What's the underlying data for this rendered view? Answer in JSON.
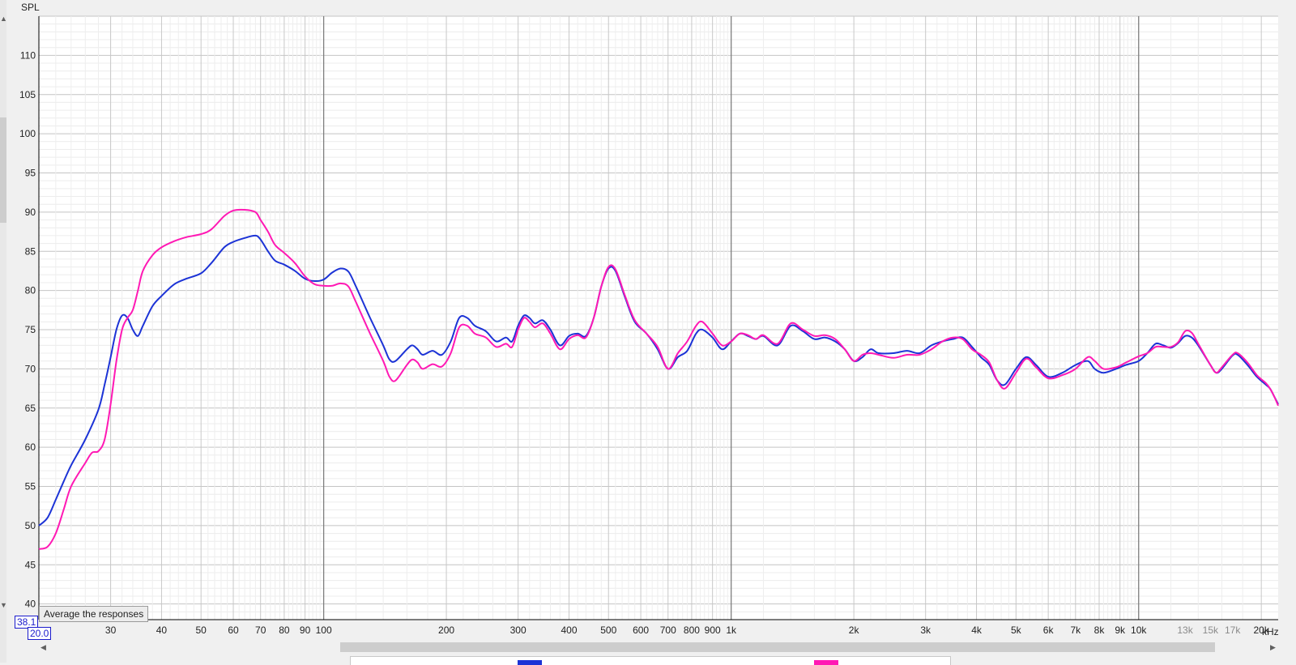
{
  "ylabel": "SPL",
  "xunit": "kHz",
  "cursor": {
    "y": "38.1",
    "x": "20.0"
  },
  "tooltip": "Average the responses",
  "colors": {
    "series1": "#1c33d6",
    "series2": "#ff19b4",
    "grid": "#d5d5d5",
    "grid_major": "#7a7a7a"
  },
  "chart_data": {
    "type": "line",
    "x_scale": "log",
    "xlim": [
      20,
      22000
    ],
    "ylim": [
      38,
      115
    ],
    "ylabel": "SPL",
    "y_ticks": [
      40,
      45,
      50,
      55,
      60,
      65,
      70,
      75,
      80,
      85,
      90,
      95,
      100,
      105,
      110
    ],
    "x_ticks": [
      {
        "v": 30,
        "label": "30"
      },
      {
        "v": 40,
        "label": "40"
      },
      {
        "v": 50,
        "label": "50"
      },
      {
        "v": 60,
        "label": "60"
      },
      {
        "v": 70,
        "label": "70"
      },
      {
        "v": 80,
        "label": "80"
      },
      {
        "v": 90,
        "label": "90"
      },
      {
        "v": 100,
        "label": "100"
      },
      {
        "v": 200,
        "label": "200"
      },
      {
        "v": 300,
        "label": "300"
      },
      {
        "v": 400,
        "label": "400"
      },
      {
        "v": 500,
        "label": "500"
      },
      {
        "v": 600,
        "label": "600"
      },
      {
        "v": 700,
        "label": "700"
      },
      {
        "v": 800,
        "label": "800"
      },
      {
        "v": 900,
        "label": "900"
      },
      {
        "v": 1000,
        "label": "1k"
      },
      {
        "v": 2000,
        "label": "2k"
      },
      {
        "v": 3000,
        "label": "3k"
      },
      {
        "v": 4000,
        "label": "4k"
      },
      {
        "v": 5000,
        "label": "5k"
      },
      {
        "v": 6000,
        "label": "6k"
      },
      {
        "v": 7000,
        "label": "7k"
      },
      {
        "v": 8000,
        "label": "8k"
      },
      {
        "v": 9000,
        "label": "9k"
      },
      {
        "v": 10000,
        "label": "10k"
      },
      {
        "v": 13000,
        "label": "13k",
        "dim": true
      },
      {
        "v": 15000,
        "label": "15k",
        "dim": true
      },
      {
        "v": 17000,
        "label": "17k",
        "dim": true
      },
      {
        "v": 20000,
        "label": "20k"
      }
    ],
    "series": [
      {
        "color": "#1c33d6",
        "points": [
          [
            20,
            50
          ],
          [
            21,
            51
          ],
          [
            22,
            53.3
          ],
          [
            23,
            55.6
          ],
          [
            24,
            57.7
          ],
          [
            26,
            61
          ],
          [
            28,
            64.8
          ],
          [
            29,
            68
          ],
          [
            30,
            71.5
          ],
          [
            31,
            75
          ],
          [
            32,
            76.8
          ],
          [
            33,
            76.5
          ],
          [
            34,
            75
          ],
          [
            35,
            74.2
          ],
          [
            36,
            75.5
          ],
          [
            38,
            78
          ],
          [
            40,
            79.3
          ],
          [
            43,
            80.8
          ],
          [
            46,
            81.5
          ],
          [
            50,
            82.2
          ],
          [
            53,
            83.5
          ],
          [
            57,
            85.5
          ],
          [
            60,
            86.2
          ],
          [
            64,
            86.7
          ],
          [
            68,
            87
          ],
          [
            70,
            86.5
          ],
          [
            73,
            85
          ],
          [
            76,
            83.8
          ],
          [
            80,
            83.3
          ],
          [
            85,
            82.5
          ],
          [
            90,
            81.5
          ],
          [
            95,
            81.2
          ],
          [
            100,
            81.4
          ],
          [
            105,
            82.3
          ],
          [
            110,
            82.8
          ],
          [
            115,
            82.4
          ],
          [
            120,
            80.5
          ],
          [
            130,
            76.5
          ],
          [
            140,
            73
          ],
          [
            145,
            71.2
          ],
          [
            150,
            71
          ],
          [
            160,
            72.5
          ],
          [
            165,
            73
          ],
          [
            170,
            72.5
          ],
          [
            175,
            71.8
          ],
          [
            185,
            72.3
          ],
          [
            195,
            71.8
          ],
          [
            205,
            73.5
          ],
          [
            215,
            76.5
          ],
          [
            225,
            76.5
          ],
          [
            235,
            75.5
          ],
          [
            250,
            74.8
          ],
          [
            265,
            73.5
          ],
          [
            280,
            74
          ],
          [
            290,
            73.5
          ],
          [
            300,
            75.5
          ],
          [
            310,
            76.8
          ],
          [
            320,
            76.5
          ],
          [
            330,
            75.8
          ],
          [
            345,
            76.2
          ],
          [
            360,
            75
          ],
          [
            380,
            73
          ],
          [
            400,
            74.2
          ],
          [
            420,
            74.5
          ],
          [
            440,
            74.2
          ],
          [
            460,
            76.5
          ],
          [
            480,
            80.5
          ],
          [
            500,
            82.8
          ],
          [
            520,
            82.5
          ],
          [
            550,
            79
          ],
          [
            580,
            76
          ],
          [
            620,
            74.5
          ],
          [
            660,
            72.5
          ],
          [
            700,
            70
          ],
          [
            740,
            71.5
          ],
          [
            780,
            72.3
          ],
          [
            820,
            74.5
          ],
          [
            850,
            75
          ],
          [
            900,
            74
          ],
          [
            950,
            72.5
          ],
          [
            1000,
            73.5
          ],
          [
            1050,
            74.5
          ],
          [
            1100,
            74.2
          ],
          [
            1150,
            73.8
          ],
          [
            1200,
            74.2
          ],
          [
            1300,
            73
          ],
          [
            1400,
            75.5
          ],
          [
            1500,
            74.8
          ],
          [
            1600,
            73.8
          ],
          [
            1700,
            74
          ],
          [
            1800,
            73.5
          ],
          [
            1900,
            72.5
          ],
          [
            2000,
            71
          ],
          [
            2100,
            71.5
          ],
          [
            2200,
            72.5
          ],
          [
            2300,
            72
          ],
          [
            2500,
            72
          ],
          [
            2700,
            72.3
          ],
          [
            2900,
            72
          ],
          [
            3100,
            73
          ],
          [
            3300,
            73.5
          ],
          [
            3500,
            73.8
          ],
          [
            3700,
            74
          ],
          [
            3900,
            72.8
          ],
          [
            4100,
            71.5
          ],
          [
            4300,
            70.5
          ],
          [
            4500,
            68.5
          ],
          [
            4700,
            68
          ],
          [
            5000,
            70
          ],
          [
            5300,
            71.5
          ],
          [
            5600,
            70.5
          ],
          [
            6000,
            69
          ],
          [
            6500,
            69.5
          ],
          [
            7000,
            70.5
          ],
          [
            7500,
            71
          ],
          [
            7800,
            70
          ],
          [
            8200,
            69.5
          ],
          [
            8800,
            70
          ],
          [
            9300,
            70.5
          ],
          [
            10000,
            71
          ],
          [
            10500,
            72
          ],
          [
            11000,
            73.2
          ],
          [
            11500,
            73
          ],
          [
            12000,
            72.7
          ],
          [
            12500,
            73.3
          ],
          [
            13000,
            74.2
          ],
          [
            13500,
            74
          ],
          [
            14000,
            73
          ],
          [
            15000,
            70.5
          ],
          [
            15500,
            69.5
          ],
          [
            16000,
            70
          ],
          [
            17000,
            71.7
          ],
          [
            17500,
            71.8
          ],
          [
            18500,
            70.5
          ],
          [
            19500,
            69
          ],
          [
            20500,
            68
          ],
          [
            21000,
            67.5
          ],
          [
            21500,
            66.5
          ],
          [
            22000,
            65.5
          ]
        ]
      },
      {
        "color": "#ff19b4",
        "points": [
          [
            20,
            47
          ],
          [
            21,
            47.3
          ],
          [
            22,
            49
          ],
          [
            23,
            52
          ],
          [
            24,
            55
          ],
          [
            26,
            58
          ],
          [
            27,
            59.3
          ],
          [
            28,
            59.5
          ],
          [
            29,
            61
          ],
          [
            30,
            65.5
          ],
          [
            31,
            71
          ],
          [
            32,
            75
          ],
          [
            33,
            76.5
          ],
          [
            34,
            77.5
          ],
          [
            35,
            80
          ],
          [
            36,
            82.5
          ],
          [
            38,
            84.5
          ],
          [
            40,
            85.5
          ],
          [
            43,
            86.3
          ],
          [
            46,
            86.8
          ],
          [
            50,
            87.2
          ],
          [
            53,
            87.8
          ],
          [
            57,
            89.5
          ],
          [
            60,
            90.2
          ],
          [
            64,
            90.3
          ],
          [
            68,
            90
          ],
          [
            70,
            89
          ],
          [
            73,
            87.5
          ],
          [
            76,
            85.8
          ],
          [
            80,
            84.8
          ],
          [
            85,
            83.5
          ],
          [
            90,
            81.8
          ],
          [
            95,
            80.8
          ],
          [
            100,
            80.6
          ],
          [
            105,
            80.6
          ],
          [
            110,
            80.9
          ],
          [
            115,
            80.5
          ],
          [
            120,
            78.5
          ],
          [
            130,
            74.5
          ],
          [
            140,
            71
          ],
          [
            145,
            69
          ],
          [
            150,
            68.5
          ],
          [
            160,
            70.5
          ],
          [
            165,
            71.2
          ],
          [
            170,
            70.8
          ],
          [
            175,
            70
          ],
          [
            185,
            70.6
          ],
          [
            195,
            70.3
          ],
          [
            205,
            72
          ],
          [
            215,
            75.3
          ],
          [
            225,
            75.5
          ],
          [
            235,
            74.5
          ],
          [
            250,
            74
          ],
          [
            265,
            72.8
          ],
          [
            280,
            73.2
          ],
          [
            290,
            72.8
          ],
          [
            300,
            75
          ],
          [
            310,
            76.5
          ],
          [
            320,
            76
          ],
          [
            330,
            75.3
          ],
          [
            345,
            75.8
          ],
          [
            360,
            74.5
          ],
          [
            380,
            72.5
          ],
          [
            400,
            73.8
          ],
          [
            420,
            74.3
          ],
          [
            440,
            74
          ],
          [
            460,
            76.5
          ],
          [
            480,
            80.5
          ],
          [
            500,
            83
          ],
          [
            520,
            82.7
          ],
          [
            550,
            79.2
          ],
          [
            580,
            76.2
          ],
          [
            620,
            74.5
          ],
          [
            660,
            72.8
          ],
          [
            700,
            70
          ],
          [
            740,
            72
          ],
          [
            780,
            73.5
          ],
          [
            820,
            75.5
          ],
          [
            850,
            76
          ],
          [
            900,
            74.5
          ],
          [
            950,
            73
          ],
          [
            1000,
            73.5
          ],
          [
            1050,
            74.5
          ],
          [
            1100,
            74.3
          ],
          [
            1150,
            73.8
          ],
          [
            1200,
            74.3
          ],
          [
            1300,
            73.2
          ],
          [
            1400,
            75.8
          ],
          [
            1500,
            75
          ],
          [
            1600,
            74.2
          ],
          [
            1700,
            74.3
          ],
          [
            1800,
            73.8
          ],
          [
            1900,
            72.5
          ],
          [
            2000,
            71
          ],
          [
            2100,
            71.8
          ],
          [
            2200,
            72
          ],
          [
            2300,
            71.8
          ],
          [
            2500,
            71.4
          ],
          [
            2700,
            71.8
          ],
          [
            2900,
            71.8
          ],
          [
            3100,
            72.5
          ],
          [
            3300,
            73.5
          ],
          [
            3500,
            74
          ],
          [
            3700,
            73.8
          ],
          [
            3900,
            72.5
          ],
          [
            4100,
            71.8
          ],
          [
            4300,
            70.8
          ],
          [
            4500,
            68.5
          ],
          [
            4700,
            67.5
          ],
          [
            5000,
            69.5
          ],
          [
            5300,
            71.3
          ],
          [
            5600,
            70.2
          ],
          [
            6000,
            68.8
          ],
          [
            6500,
            69.2
          ],
          [
            7000,
            70
          ],
          [
            7500,
            71.5
          ],
          [
            7800,
            71
          ],
          [
            8200,
            70
          ],
          [
            8800,
            70.2
          ],
          [
            9300,
            70.8
          ],
          [
            10000,
            71.6
          ],
          [
            10500,
            72
          ],
          [
            11000,
            72.8
          ],
          [
            11500,
            72.8
          ],
          [
            12000,
            72.8
          ],
          [
            12500,
            73.4
          ],
          [
            13000,
            74.8
          ],
          [
            13500,
            74.6
          ],
          [
            14000,
            73.2
          ],
          [
            15000,
            70.5
          ],
          [
            15500,
            69.5
          ],
          [
            16000,
            70.2
          ],
          [
            17000,
            71.8
          ],
          [
            17500,
            72
          ],
          [
            18500,
            70.8
          ],
          [
            19500,
            69.2
          ],
          [
            20500,
            68.2
          ],
          [
            21000,
            67.5
          ],
          [
            21500,
            66.5
          ],
          [
            22000,
            65.3
          ]
        ]
      }
    ]
  }
}
